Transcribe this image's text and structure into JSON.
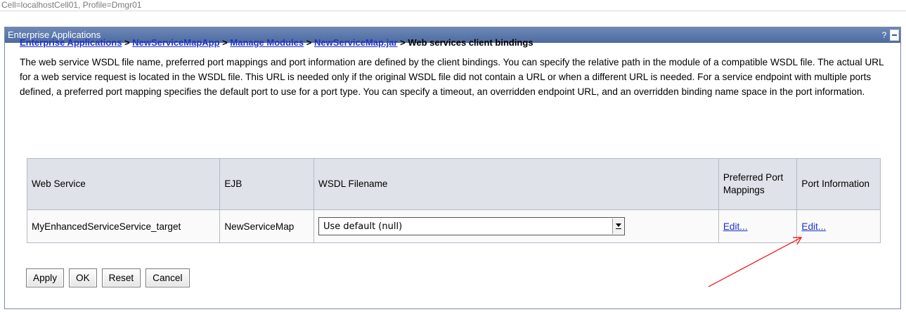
{
  "context": {
    "text": "Cell=localhostCell01, Profile=Dmgr01"
  },
  "panel": {
    "title": "Enterprise Applications",
    "help_label": "?"
  },
  "breadcrumb": {
    "items": [
      {
        "label": "Enterprise Applications",
        "link": true
      },
      {
        "label": "NewServiceMapApp",
        "link": true
      },
      {
        "label": "Manage Modules",
        "link": true
      },
      {
        "label": "NewServiceMap.jar",
        "link": true
      },
      {
        "label": "Web services client bindings",
        "link": false
      }
    ],
    "separator": ">"
  },
  "description": "The web service WSDL file name, preferred port mappings and port information are defined by the client bindings. You can specify the relative path in the module of a compatible WSDL file. The actual URL for a web service request is located in the WSDL file. This URL is needed only if the original WSDL file did not contain a URL or when a different URL is needed. For a service endpoint with multiple ports defined, a preferred port mapping specifies the default port to use for a port type. You can specify a timeout, an overridden endpoint URL, and an overridden binding name space in the port information.",
  "table": {
    "columns": [
      "Web Service",
      "EJB",
      "WSDL Filename",
      "Preferred Port Mappings",
      "Port Information"
    ],
    "rows": [
      {
        "web_service": "MyEnhancedServiceService_target",
        "ejb": "NewServiceMap",
        "wsdl_filename": "Use default (null)",
        "preferred_port_mappings": "Edit...",
        "port_information": "Edit..."
      }
    ]
  },
  "buttons": {
    "apply": "Apply",
    "ok": "OK",
    "reset": "Reset",
    "cancel": "Cancel"
  },
  "colors": {
    "header_bar": "#5a77aa",
    "link": "#1f33c4",
    "annotation_arrow": "#ff0000"
  }
}
